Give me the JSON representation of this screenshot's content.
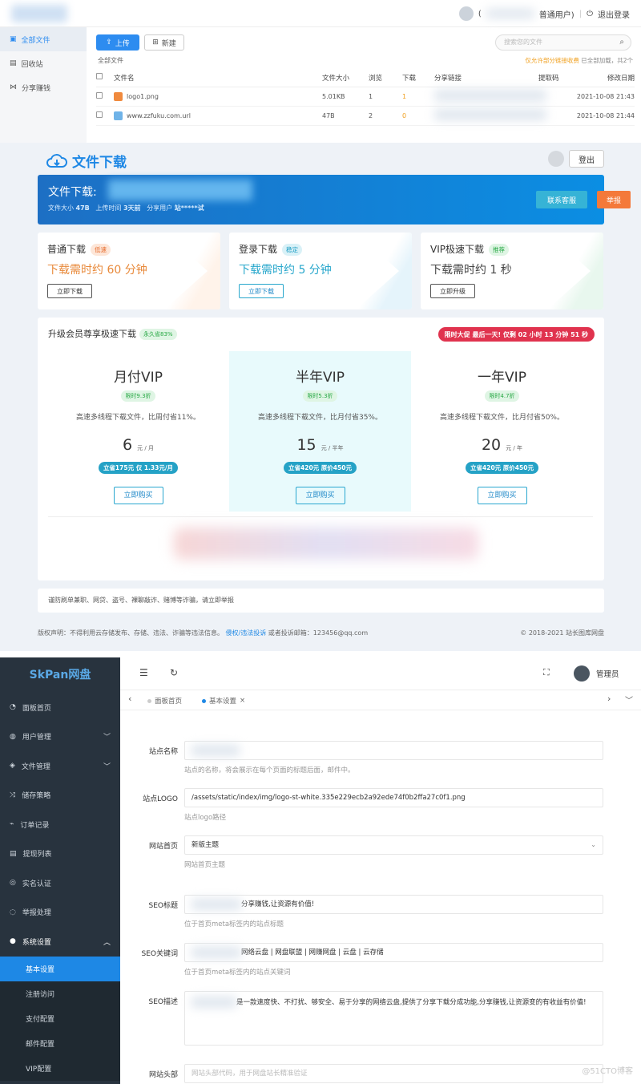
{
  "fm": {
    "user": "普通用户)",
    "user_prefix": "(",
    "logout": "退出登录",
    "sidebar": [
      {
        "label": "全部文件",
        "icon": "folder-icon"
      },
      {
        "label": "回收站",
        "icon": "trash-icon"
      },
      {
        "label": "分享赚钱",
        "icon": "share-icon"
      }
    ],
    "upload": "上传",
    "new": "新建",
    "search_placeholder": "搜索您的文件",
    "crumb": "全部文件",
    "quota_tip": "仅允许部分链接收费",
    "quota_rest": "已全部加载，共2个",
    "columns": [
      "文件名",
      "文件大小",
      "浏览",
      "下载",
      "分享链接",
      "提取码",
      "修改日期"
    ],
    "rows": [
      {
        "name": "logo1.png",
        "size": "5.01KB",
        "views": "1",
        "downloads": "1",
        "date": "2021-10-08 21:43"
      },
      {
        "name": "www.zzfuku.com.url",
        "size": "47B",
        "views": "2",
        "downloads": "0",
        "date": "2021-10-08 21:44"
      }
    ]
  },
  "dl": {
    "brand": "文件下载",
    "logout": "登出",
    "title": "文件下载:",
    "meta_size_label": "文件大小",
    "meta_size": "47B",
    "meta_time_label": "上传时间",
    "meta_time": "3天前",
    "meta_user_label": "分享用户",
    "meta_user": "站*****试",
    "contact": "联系客服",
    "report": "举报",
    "cards": [
      {
        "name": "普通下载",
        "tag": "低速",
        "time": "下载需时约 60 分钟",
        "btn": "立即下载"
      },
      {
        "name": "登录下载",
        "tag": "稳定",
        "time": "下载需时约 5 分钟",
        "btn": "立即下载"
      },
      {
        "name": "VIP极速下载",
        "tag": "推荐",
        "time": "下载需时约 1 秒",
        "btn": "立即升级"
      }
    ],
    "vip_head": "升级会员尊享极速下载",
    "vip_disc": "永久省83%",
    "timer": "限时大促 最后一天! 仅剩 02 小时 13 分钟 51 秒",
    "plans": [
      {
        "name": "月付VIP",
        "badge": "限时9.3折",
        "desc": "高速多线程下载文件，比周付省11%。",
        "price": "6",
        "unit": "元 / 月",
        "save": "立省175元 仅 1.33元/月",
        "buy": "立即购买"
      },
      {
        "name": "半年VIP",
        "badge": "限时5.3折",
        "desc": "高速多线程下载文件，比月付省35%。",
        "price": "15",
        "unit": "元 / 半年",
        "save": "立省420元 原价450元",
        "buy": "立即购买"
      },
      {
        "name": "一年VIP",
        "badge": "限时4.7折",
        "desc": "高速多线程下载文件，比月付省50%。",
        "price": "20",
        "unit": "元 / 年",
        "save": "立省420元 原价450元",
        "buy": "立即购买"
      }
    ],
    "notice": "谨防刷单兼职、网贷、盗号、裸聊敲诈、赌博等诈骗，请立即举报",
    "footer_left": "版权声明：不得利用云存储发布、存储、违法、诈骗等违法信息。",
    "footer_link": "侵权/违法投诉",
    "footer_mail": "或者投诉邮箱：123456@qq.com",
    "copyright": "© 2018-2021 站长图库网盘"
  },
  "admin": {
    "brand": "SkPan网盘",
    "menu": [
      {
        "label": "面板首页",
        "icon": "dashboard-icon"
      },
      {
        "label": "用户管理",
        "icon": "users-icon",
        "chevron": "﹀"
      },
      {
        "label": "文件管理",
        "icon": "files-icon",
        "chevron": "﹀"
      },
      {
        "label": "储存策略",
        "icon": "storage-icon"
      },
      {
        "label": "订单记录",
        "icon": "orders-icon"
      },
      {
        "label": "提现列表",
        "icon": "withdraw-icon"
      },
      {
        "label": "实名认证",
        "icon": "verify-icon"
      },
      {
        "label": "举报处理",
        "icon": "report-icon"
      },
      {
        "label": "系统设置",
        "icon": "settings-icon",
        "chevron": "︿"
      }
    ],
    "submenu": [
      "基本设置",
      "注册访问",
      "支付配置",
      "邮件配置",
      "VIP配置"
    ],
    "username": "管理员",
    "tabs": [
      "面板首页",
      "基本设置"
    ],
    "fields": [
      {
        "label": "站点名称",
        "value": "",
        "hint": "站点的名称，将会展示在每个页面的标题后面，邮件中。"
      },
      {
        "label": "站点LOGO",
        "value": "/assets/static/index/img/logo-st-white.335e229ecb2a92ede74f0b2ffa27c0f1.png",
        "hint": "站点logo路径"
      },
      {
        "label": "网站首页",
        "value": "新版主题",
        "hint": "网站首页主题"
      },
      {
        "label": "SEO标题",
        "value": "分享赚钱,让资源有价值!",
        "hint": "位于首页meta标签内的站点标题"
      },
      {
        "label": "SEO关键词",
        "value": "网络云盘 | 网盘联盟 | 网赚网盘 | 云盘 | 云存储",
        "hint": "位于首页meta标签内的站点关键词"
      },
      {
        "label": "SEO描述",
        "value": "是一款速度快、不打扰、够安全、易于分享的网络云盘,提供了分享下载分成功能,分享赚钱,让资源变的有收益有价值!"
      },
      {
        "label": "网站头部",
        "value": "网站头部代码，用于网盘站长精准验证"
      }
    ],
    "watermark": "@51CTO博客"
  }
}
